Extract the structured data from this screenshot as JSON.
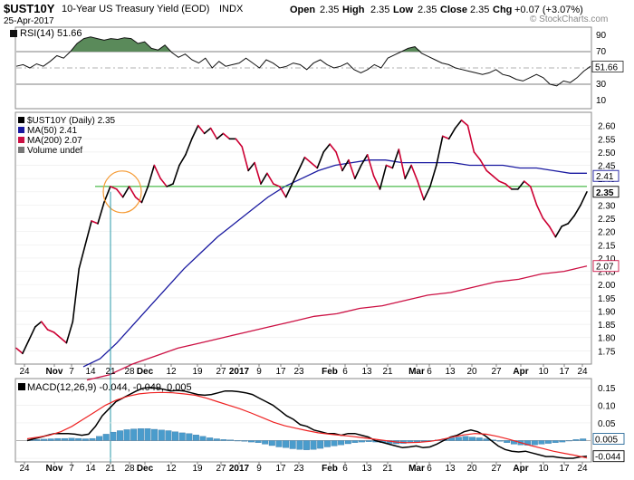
{
  "header": {
    "symbol": "$UST10Y",
    "description": "10-Year US Treasury Yield (EOD)",
    "exchange": "INDX",
    "date": "25-Apr-2017",
    "open_label": "Open",
    "open_value": "2.35",
    "high_label": "High",
    "high_value": "2.35",
    "low_label": "Low",
    "low_value": "2.35",
    "close_label": "Close",
    "close_value": "2.35",
    "chg_label": "Chg",
    "chg_value": "+0.07 (+3.07%)",
    "watermark": "© StockCharts.com"
  },
  "colors": {
    "price": "#000000",
    "ma50": "#1a1aa0",
    "ma200": "#cc1144",
    "price_down": "#cc0033",
    "rsi_fill": "#5a8a5a",
    "support_line": "#22aa22",
    "circle": "#f59a33",
    "vline": "#2a9aa8",
    "macd_hist": "#4a9ccc",
    "macd_signal": "#ee2222"
  },
  "chart_data": [
    {
      "type": "line",
      "panel": "RSI",
      "legend": "RSI(14) 51.66",
      "ylim": [
        0,
        100
      ],
      "y_ticks": [
        "90",
        "70",
        "50",
        "30",
        "10"
      ],
      "last_value_label": "51.66",
      "reference_lines": [
        70,
        30
      ],
      "values": [
        52,
        54,
        50,
        55,
        52,
        58,
        65,
        62,
        70,
        80,
        86,
        88,
        86,
        84,
        86,
        85,
        87,
        86,
        80,
        82,
        74,
        72,
        78,
        69,
        63,
        67,
        60,
        56,
        62,
        50,
        58,
        52,
        54,
        56,
        62,
        56,
        50,
        60,
        56,
        50,
        52,
        56,
        54,
        48,
        56,
        60,
        54,
        50,
        52,
        56,
        48,
        44,
        48,
        54,
        50,
        62,
        66,
        70,
        74,
        76,
        68,
        64,
        60,
        56,
        54,
        50,
        48,
        46,
        44,
        42,
        44,
        48,
        42,
        40,
        36,
        34,
        38,
        42,
        38,
        30,
        28,
        34,
        32,
        38,
        46,
        52
      ]
    },
    {
      "type": "line",
      "panel": "Price",
      "legend": [
        "$UST10Y (Daily) 2.35",
        "MA(50) 2.41",
        "MA(200) 2.07",
        "Volume undef"
      ],
      "ylim": [
        1.7,
        2.65
      ],
      "y_ticks": [
        "2.60",
        "2.55",
        "2.50",
        "2.45",
        "2.40",
        "2.35",
        "2.30",
        "2.25",
        "2.20",
        "2.15",
        "2.10",
        "2.05",
        "2.00",
        "1.95",
        "1.90",
        "1.85",
        "1.80",
        "1.75"
      ],
      "last_value_labels": [
        "2.41",
        "2.35",
        "2.07"
      ],
      "x_tick_labels": [
        "24",
        "Nov",
        "7",
        "14",
        "21",
        "28",
        "Dec",
        "12",
        "19",
        "27",
        "2017",
        "9",
        "17",
        "23",
        "Feb",
        "6",
        "13",
        "21",
        "Mar",
        "6",
        "13",
        "20",
        "27",
        "Apr",
        "10",
        "17",
        "24"
      ],
      "support_level": 2.37,
      "series": [
        {
          "name": "$UST10Y (Daily)",
          "values": [
            1.76,
            1.74,
            1.79,
            1.84,
            1.86,
            1.83,
            1.82,
            1.8,
            1.78,
            1.86,
            2.06,
            2.15,
            2.24,
            2.23,
            2.31,
            2.37,
            2.36,
            2.33,
            2.37,
            2.33,
            2.31,
            2.37,
            2.45,
            2.4,
            2.37,
            2.38,
            2.45,
            2.49,
            2.55,
            2.6,
            2.57,
            2.59,
            2.55,
            2.57,
            2.55,
            2.55,
            2.52,
            2.43,
            2.46,
            2.38,
            2.42,
            2.38,
            2.37,
            2.33,
            2.38,
            2.43,
            2.48,
            2.46,
            2.44,
            2.5,
            2.53,
            2.5,
            2.43,
            2.47,
            2.4,
            2.45,
            2.49,
            2.41,
            2.36,
            2.45,
            2.44,
            2.51,
            2.4,
            2.45,
            2.39,
            2.32,
            2.37,
            2.45,
            2.56,
            2.55,
            2.59,
            2.62,
            2.6,
            2.5,
            2.47,
            2.43,
            2.41,
            2.39,
            2.38,
            2.36,
            2.36,
            2.39,
            2.37,
            2.3,
            2.25,
            2.22,
            2.18,
            2.22,
            2.23,
            2.26,
            2.3,
            2.35
          ]
        },
        {
          "name": "MA(50)",
          "values": [
            1.69,
            1.72,
            1.78,
            1.85,
            1.92,
            1.99,
            2.06,
            2.12,
            2.18,
            2.23,
            2.28,
            2.33,
            2.37,
            2.4,
            2.43,
            2.45,
            2.46,
            2.47,
            2.47,
            2.46,
            2.46,
            2.46,
            2.46,
            2.45,
            2.45,
            2.45,
            2.44,
            2.44,
            2.43,
            2.42,
            2.42
          ]
        },
        {
          "name": "MA(200)",
          "values": [
            1.64,
            1.66,
            1.7,
            1.73,
            1.76,
            1.78,
            1.8,
            1.82,
            1.84,
            1.86,
            1.88,
            1.89,
            1.91,
            1.92,
            1.94,
            1.96,
            1.97,
            1.99,
            2.01,
            2.02,
            2.04,
            2.05,
            2.07
          ]
        }
      ]
    },
    {
      "type": "line",
      "panel": "MACD",
      "legend": "MACD(12,26,9) -0.044, -0.049, 0.005",
      "ylim": [
        -0.055,
        0.17
      ],
      "y_ticks": [
        "0.15",
        "0.10",
        "0.05",
        "0.00",
        "-0.05"
      ],
      "last_value_labels": [
        "0.005",
        "-0.044"
      ],
      "series": [
        {
          "name": "MACD",
          "values": [
            0.0,
            0.005,
            0.01,
            0.015,
            0.02,
            0.02,
            0.02,
            0.018,
            0.015,
            0.018,
            0.04,
            0.07,
            0.09,
            0.11,
            0.12,
            0.13,
            0.14,
            0.148,
            0.15,
            0.148,
            0.145,
            0.14,
            0.142,
            0.14,
            0.135,
            0.13,
            0.128,
            0.13,
            0.135,
            0.14,
            0.14,
            0.138,
            0.135,
            0.13,
            0.12,
            0.11,
            0.1,
            0.085,
            0.07,
            0.06,
            0.045,
            0.04,
            0.03,
            0.025,
            0.02,
            0.02,
            0.015,
            0.02,
            0.02,
            0.015,
            0.01,
            0.0,
            -0.005,
            -0.01,
            -0.015,
            -0.02,
            -0.018,
            -0.015,
            -0.02,
            -0.018,
            -0.01,
            0.0,
            0.01,
            0.015,
            0.025,
            0.03,
            0.025,
            0.015,
            0.0,
            -0.015,
            -0.025,
            -0.03,
            -0.032,
            -0.03,
            -0.035,
            -0.04,
            -0.045,
            -0.045,
            -0.048,
            -0.05,
            -0.05,
            -0.046,
            -0.044
          ]
        },
        {
          "name": "Signal",
          "values": [
            0.005,
            0.01,
            0.015,
            0.025,
            0.04,
            0.06,
            0.08,
            0.1,
            0.115,
            0.125,
            0.132,
            0.135,
            0.136,
            0.135,
            0.132,
            0.128,
            0.12,
            0.11,
            0.1,
            0.09,
            0.078,
            0.065,
            0.052,
            0.042,
            0.035,
            0.028,
            0.022,
            0.018,
            0.015,
            0.012,
            0.008,
            0.004,
            0.0,
            -0.004,
            -0.006,
            -0.005,
            -0.002,
            0.003,
            0.01,
            0.016,
            0.02,
            0.018,
            0.012,
            0.004,
            -0.005,
            -0.014,
            -0.022,
            -0.03,
            -0.036,
            -0.042,
            -0.049
          ]
        },
        {
          "name": "Histogram",
          "values": [
            0.002,
            0.003,
            0.004,
            0.005,
            0.006,
            0.006,
            0.007,
            0.006,
            0.005,
            0.006,
            0.012,
            0.018,
            0.024,
            0.028,
            0.031,
            0.033,
            0.034,
            0.034,
            0.032,
            0.03,
            0.028,
            0.025,
            0.022,
            0.02,
            0.016,
            0.012,
            0.008,
            0.005,
            0.003,
            0.002,
            0.0,
            -0.002,
            -0.004,
            -0.006,
            -0.01,
            -0.014,
            -0.018,
            -0.02,
            -0.023,
            -0.025,
            -0.026,
            -0.025,
            -0.022,
            -0.018,
            -0.015,
            -0.012,
            -0.009,
            -0.006,
            -0.004,
            -0.003,
            -0.004,
            -0.006,
            -0.008,
            -0.009,
            -0.008,
            -0.006,
            -0.004,
            -0.002,
            -0.001,
            0.002,
            0.005,
            0.008,
            0.01,
            0.012,
            0.01,
            0.008,
            0.005,
            0.002,
            -0.002,
            -0.006,
            -0.01,
            -0.012,
            -0.013,
            -0.012,
            -0.01,
            -0.008,
            -0.006,
            -0.004,
            0.0,
            0.003,
            0.005
          ]
        }
      ]
    }
  ]
}
